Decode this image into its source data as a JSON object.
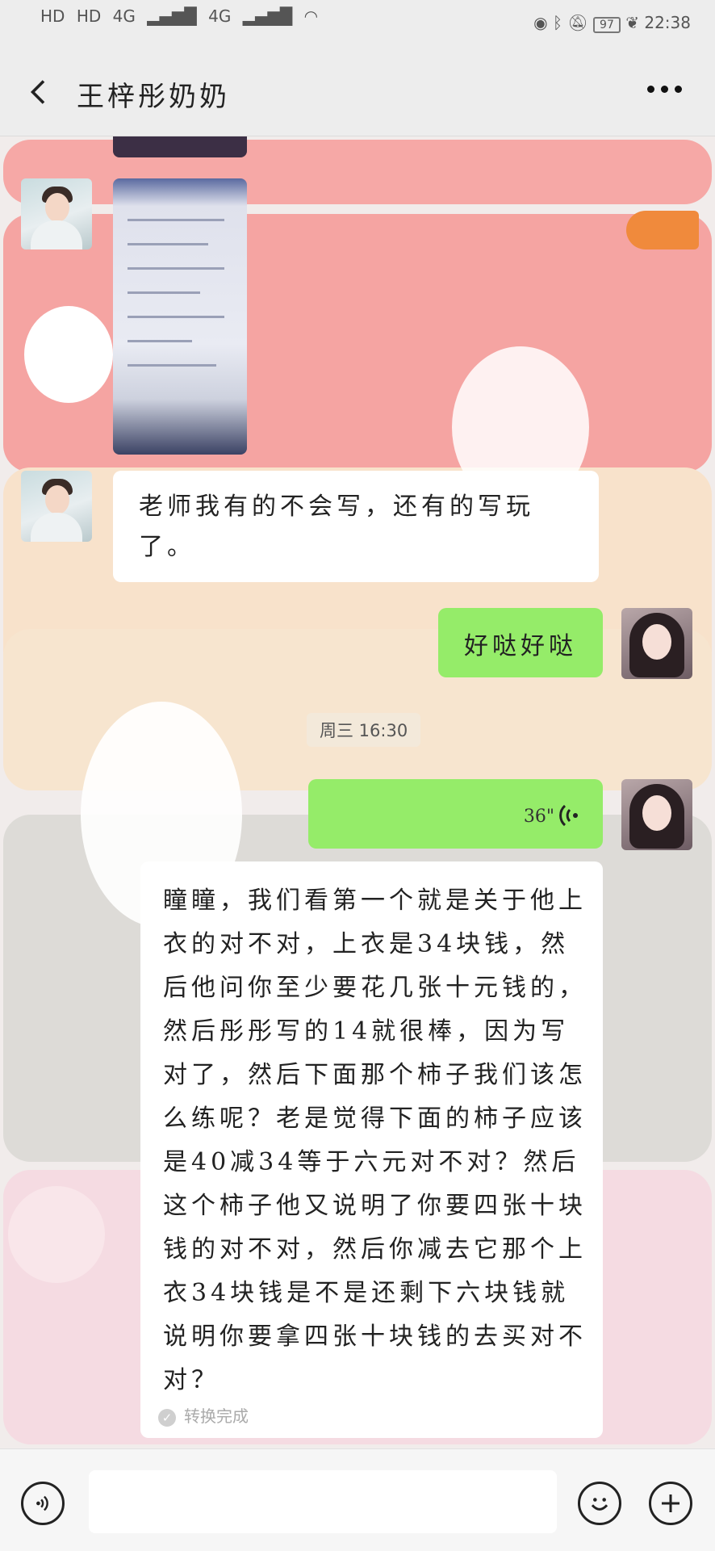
{
  "status": {
    "left_indicators": [
      "HD",
      "HD",
      "4G",
      "4G"
    ],
    "battery": "97",
    "time": "22:38"
  },
  "header": {
    "title": "王梓彤奶奶"
  },
  "messages": {
    "incoming_text": "老师我有的不会写，还有的写玩了。",
    "outgoing_text": "好哒好哒",
    "timestamp": "周三 16:30",
    "voice_duration": "36\"",
    "transcript": "瞳瞳，我们看第一个就是关于他上衣的对不对，上衣是34块钱，然后他问你至少要花几张十元钱的，然后彤彤写的14就很棒，因为写对了，然后下面那个柿子我们该怎么练呢？老是觉得下面的柿子应该是40减34等于六元对不对？然后这个柿子他又说明了你要四张十块钱的对不对，然后你减去它那个上衣34块钱是不是还剩下六块钱就说明你要拿四张十块钱的去买对不对？",
    "transcript_status": "转换完成"
  },
  "colors": {
    "header_bg": "#ededed",
    "bubble_out": "#95ec69",
    "bubble_in": "#ffffff",
    "band_pink": "#f6a8a6",
    "band_peach": "#f8e2cb",
    "band_grey": "#d8d6d2",
    "band_lightpink": "#f6d8e0"
  },
  "icons": {
    "back": "chevron-left-icon",
    "more": "more-dots-icon",
    "voice": "voice-input-icon",
    "emoji": "emoji-icon",
    "plus": "plus-icon"
  }
}
